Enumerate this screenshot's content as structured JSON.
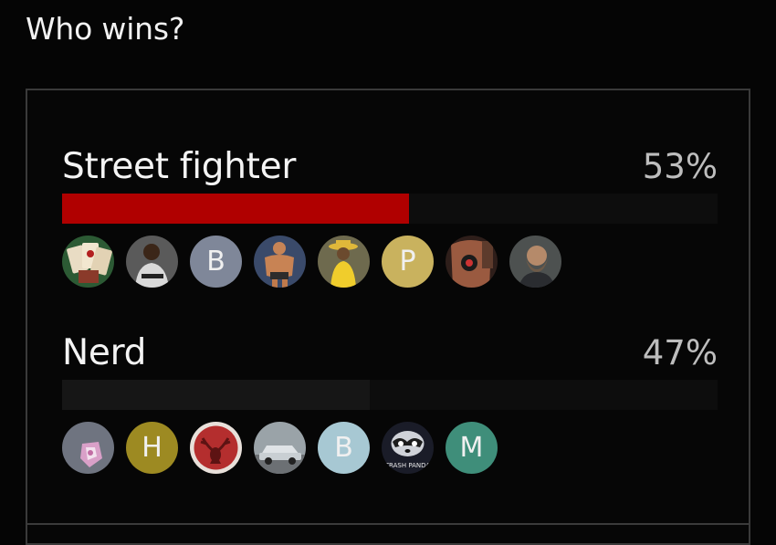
{
  "question": "Who wins?",
  "options": [
    {
      "label": "Street fighter",
      "percent_text": "53%",
      "vote_fraction": 0.53,
      "bar_color": "#b00000",
      "voters": [
        {
          "type": "image",
          "icon": "playing-cards-avatar-icon"
        },
        {
          "type": "image",
          "icon": "spurs-player-avatar-icon"
        },
        {
          "type": "letter",
          "letter": "B",
          "color": "#7f8799"
        },
        {
          "type": "image",
          "icon": "bodybuilder-avatar-icon"
        },
        {
          "type": "image",
          "icon": "yellow-hat-man-avatar-icon"
        },
        {
          "type": "letter",
          "letter": "P",
          "color": "#c9b25e"
        },
        {
          "type": "image",
          "icon": "tattoo-avatar-icon"
        },
        {
          "type": "image",
          "icon": "bearded-man-avatar-icon"
        }
      ]
    },
    {
      "label": "Nerd",
      "percent_text": "47%",
      "vote_fraction": 0.47,
      "bar_color": "#161616",
      "voters": [
        {
          "type": "image",
          "icon": "pattern-avatar-icon"
        },
        {
          "type": "letter",
          "letter": "H",
          "color": "#9d8a22"
        },
        {
          "type": "image",
          "icon": "elk-avatar-icon"
        },
        {
          "type": "image",
          "icon": "car-avatar-icon"
        },
        {
          "type": "letter",
          "letter": "B",
          "color": "#a7c8d3"
        },
        {
          "type": "image",
          "icon": "trash-panda-avatar-icon",
          "text": "TRASH PANDA"
        },
        {
          "type": "letter",
          "letter": "M",
          "color": "#3f8e7a"
        }
      ]
    }
  ]
}
